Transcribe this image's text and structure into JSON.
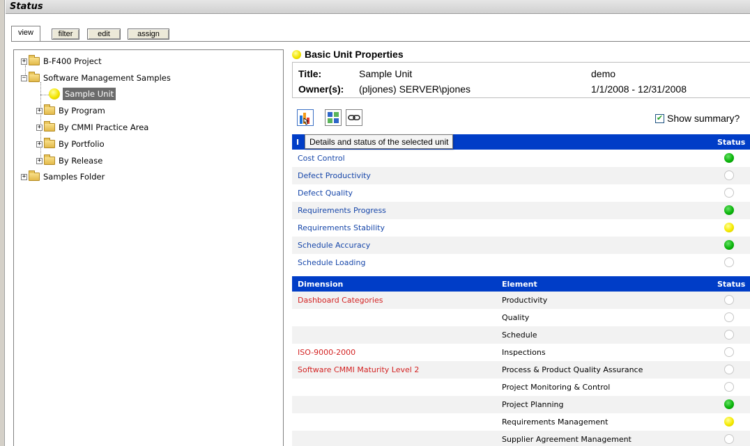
{
  "window": {
    "title": "Status"
  },
  "tabs": [
    {
      "label": "view",
      "active": true
    },
    {
      "label": "filter",
      "active": false
    },
    {
      "label": "edit",
      "active": false
    },
    {
      "label": "assign",
      "active": false
    }
  ],
  "tree": {
    "items": [
      {
        "label": "B-F400 Project",
        "expanded": false
      },
      {
        "label": "Software Management Samples",
        "expanded": true
      },
      {
        "label": "Sample Unit",
        "selected": true
      },
      {
        "label": "By Program",
        "expanded": false
      },
      {
        "label": "By CMMI Practice Area",
        "expanded": false
      },
      {
        "label": "By Portfolio",
        "expanded": false
      },
      {
        "label": "By Release",
        "expanded": false
      },
      {
        "label": "Samples Folder",
        "expanded": false
      }
    ]
  },
  "properties": {
    "header": "Basic Unit Properties",
    "title_label": "Title:",
    "title_value": "Sample Unit",
    "title_extra": "demo",
    "owner_label": "Owner(s):",
    "owner_value": "(pljones) SERVER\\pjones",
    "owner_extra": "1/1/2008 - 12/31/2008"
  },
  "toolbar": {
    "tooltip": "Details and status of the selected unit",
    "show_summary_label": "Show summary?",
    "show_summary_checked": true
  },
  "indicators": {
    "header_col1": "I",
    "header_status": "Status",
    "rows": [
      {
        "name": "Cost Control",
        "status": "green"
      },
      {
        "name": "Defect Productivity",
        "status": "empty"
      },
      {
        "name": "Defect Quality",
        "status": "empty"
      },
      {
        "name": "Requirements Progress",
        "status": "green"
      },
      {
        "name": "Requirements Stability",
        "status": "yellow"
      },
      {
        "name": "Schedule Accuracy",
        "status": "green"
      },
      {
        "name": "Schedule Loading",
        "status": "empty"
      }
    ]
  },
  "dimensions": {
    "header_dimension": "Dimension",
    "header_element": "Element",
    "header_status": "Status",
    "rows": [
      {
        "dimension": "Dashboard Categories",
        "element": "Productivity",
        "status": "empty"
      },
      {
        "dimension": "",
        "element": "Quality",
        "status": "empty"
      },
      {
        "dimension": "",
        "element": "Schedule",
        "status": "empty"
      },
      {
        "dimension": "ISO-9000-2000",
        "element": "Inspections",
        "status": "empty"
      },
      {
        "dimension": "Software CMMI Maturity Level 2",
        "element": "Process & Product Quality Assurance",
        "status": "empty"
      },
      {
        "dimension": "",
        "element": "Project Monitoring & Control",
        "status": "empty"
      },
      {
        "dimension": "",
        "element": "Project Planning",
        "status": "green"
      },
      {
        "dimension": "",
        "element": "Requirements Management",
        "status": "yellow"
      },
      {
        "dimension": "",
        "element": "Supplier Agreement Management",
        "status": "empty"
      }
    ]
  }
}
